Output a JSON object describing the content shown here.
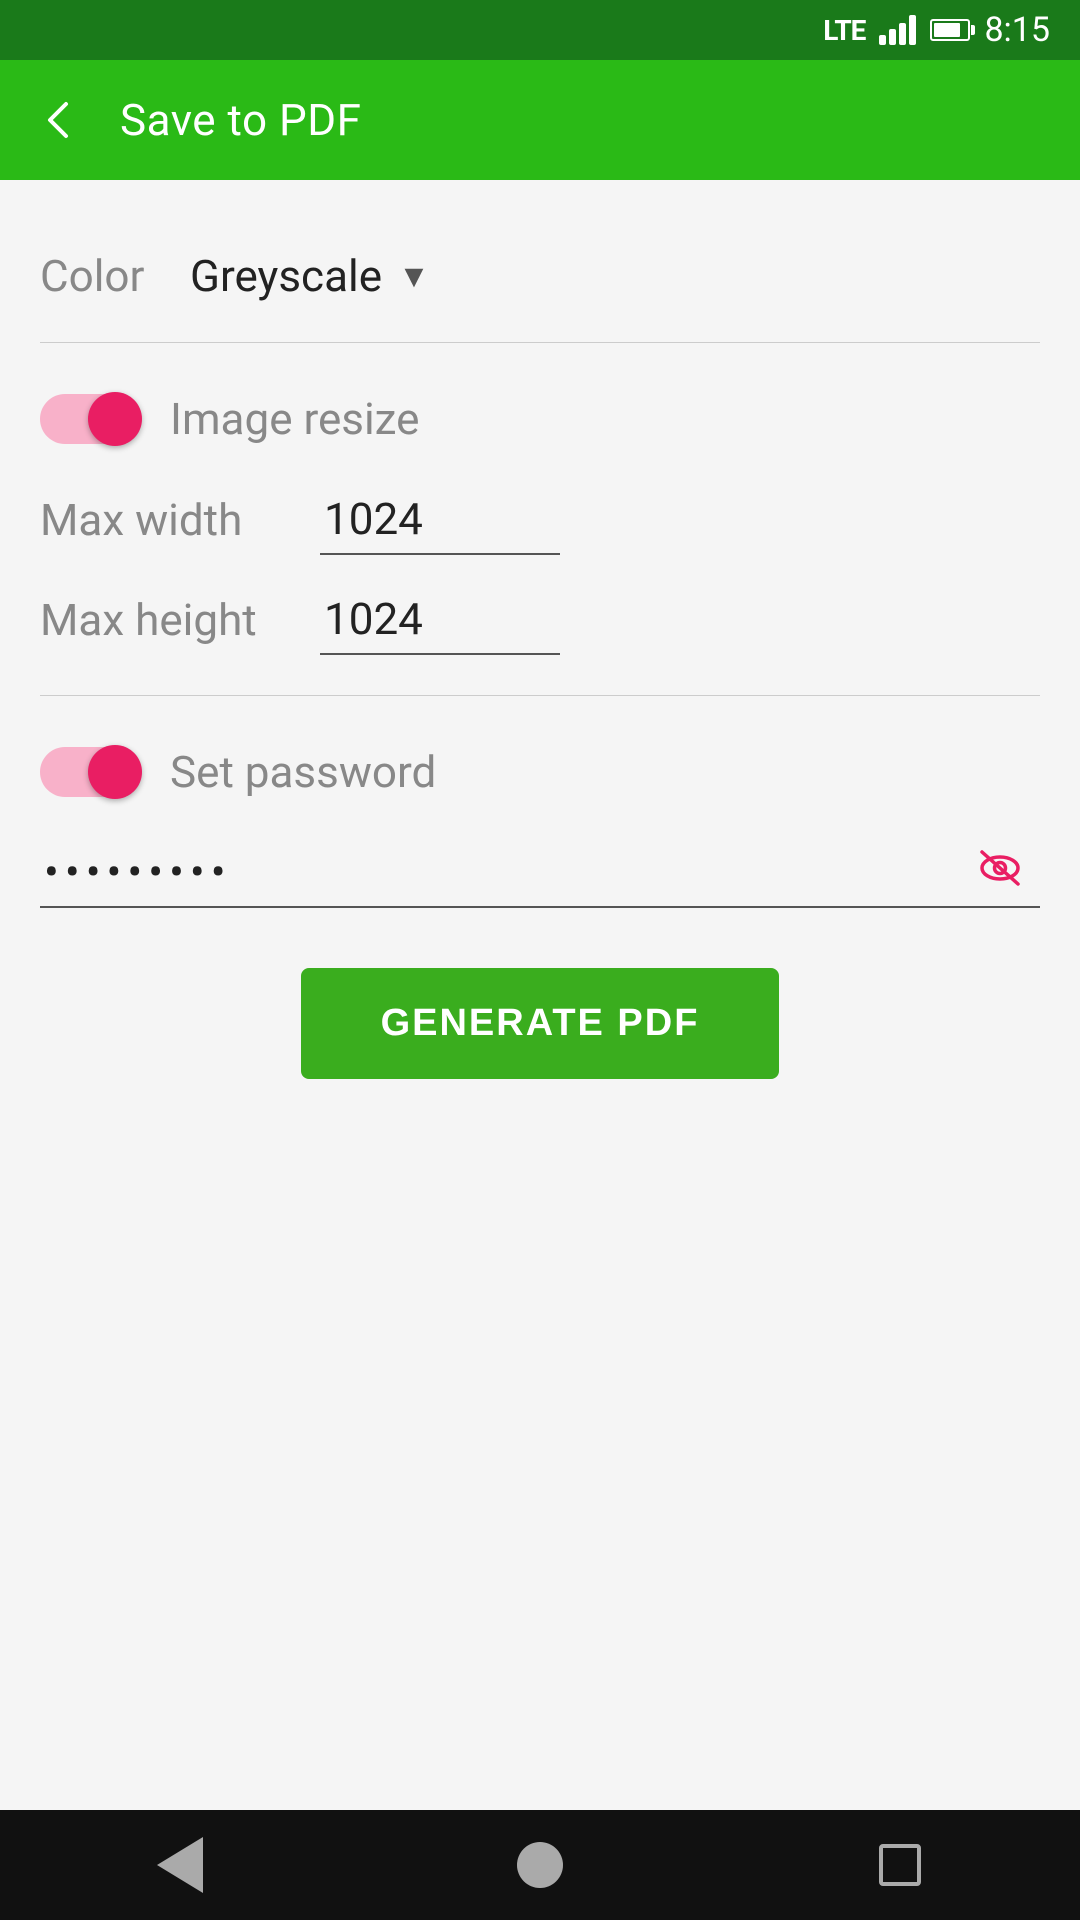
{
  "statusBar": {
    "time": "8:15",
    "lte": "LTE"
  },
  "appBar": {
    "title": "Save to PDF",
    "backArrow": "←"
  },
  "form": {
    "colorLabel": "Color",
    "colorValue": "Greyscale",
    "imageResizeLabel": "Image resize",
    "maxWidthLabel": "Max width",
    "maxWidthValue": "1024",
    "maxHeightLabel": "Max height",
    "maxHeightValue": "1024",
    "setPasswordLabel": "Set password",
    "passwordValue": "••••••••",
    "generateButton": "GENERATE PDF"
  }
}
